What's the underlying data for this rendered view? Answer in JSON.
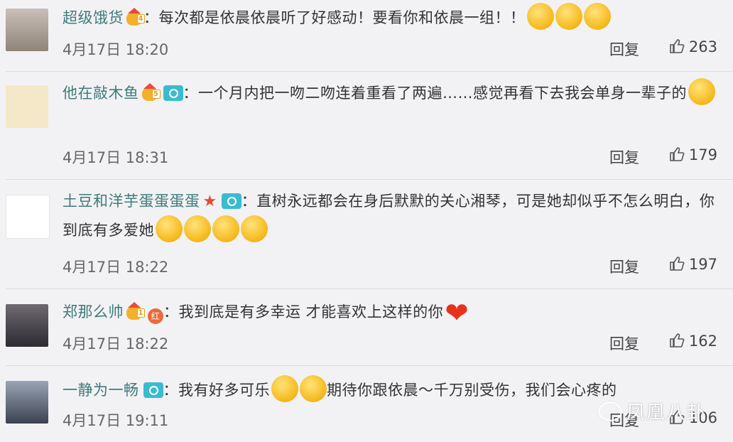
{
  "comments": [
    {
      "user": "超级饿货",
      "level": "4",
      "text": "：每次都是依晨依晨听了好感动！要看你和依晨一组！！",
      "time": "4月17日 18:20",
      "reply": "回复",
      "likes": "263"
    },
    {
      "user": "他在敲木鱼",
      "level": "5",
      "text": "：一个月内把一吻二吻连着重看了两遍……感觉再看下去我会单身一辈子的",
      "time": "4月17日 18:31",
      "reply": "回复",
      "likes": "179"
    },
    {
      "user": "土豆和洋芋蛋蛋蛋蛋",
      "text": "：直树永远都会在身后默默的关心湘琴，可是她却似乎不怎么明白，你到底有多爱她",
      "time": "4月17日 18:22",
      "reply": "回复",
      "likes": "197"
    },
    {
      "user": "郑那么帅",
      "level": "1",
      "red_badge": "红",
      "text": "：我到底是有多幸运 才能喜欢上这样的你",
      "time": "4月17日 18:22",
      "reply": "回复",
      "likes": "162"
    },
    {
      "user": "一静为一畅",
      "text": "：我有好多可乐",
      "text2": "期待你跟依晨～千万别受伤，我们会心疼的",
      "time": "4月17日 19:11",
      "reply": "回复",
      "likes": "106"
    }
  ],
  "watermark": "凤凰八卦",
  "icons": {
    "like": "thumbs-up-icon",
    "crown": "crown-icon",
    "camera": "camera-icon"
  }
}
